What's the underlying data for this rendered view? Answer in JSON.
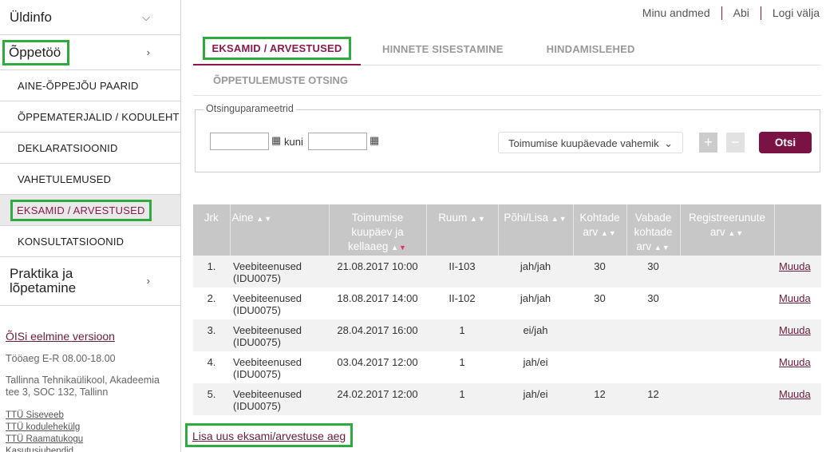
{
  "sidebar": {
    "uldinfo": "Üldinfo",
    "oppetoo": "Õppetöö",
    "items": [
      {
        "label": "AINE-ÕPPEJÕU PAARID"
      },
      {
        "label": "ÕPPEMATERJALID / KODULEHT"
      },
      {
        "label": "DEKLARATSIOONID"
      },
      {
        "label": "VAHETULEMUSED"
      },
      {
        "label": "EKSAMID / ARVESTUSED"
      },
      {
        "label": "KONSULTATSIOONID"
      }
    ],
    "praktika": "Praktika ja lõpetamine",
    "old_version": "ÕISi eelmine versioon",
    "hours": "Tööaeg E-R 08.00-18.00",
    "address": "Tallinna Tehnikaülikool, Akadeemia tee 3, SOC 132, Tallinn",
    "links": [
      "TTÜ Siseveeb",
      "TTÜ kodulehekülg",
      "TTÜ Raamatukogu",
      "Kasutusjuhendid"
    ]
  },
  "header": {
    "links": [
      "Minu andmed",
      "Abi",
      "Logi välja"
    ]
  },
  "tabs": {
    "row1": [
      "EKSAMID / ARVESTUSED",
      "HINNETE SISESTAMINE",
      "HINDAMISLEHED"
    ],
    "row2": [
      "ÕPPETULEMUSTE OTSING"
    ]
  },
  "search": {
    "legend": "Otsinguparameetrid",
    "kuni": "kuni",
    "range_select": "Toimumise kuupäevade vahemik",
    "plus": "+",
    "minus": "−",
    "submit": "Otsi"
  },
  "table": {
    "headers": [
      "Jrk",
      "Aine",
      "Toimumise kuupäev ja kellaaeg",
      "Ruum",
      "Põhi/Lisa",
      "Kohtade arv",
      "Vabade kohtade arv",
      "Registreerunute arv",
      ""
    ],
    "rows": [
      {
        "jrk": "1.",
        "aine": "Veebiteenused (IDU0075)",
        "aeg": "21.08.2017 10:00",
        "ruum": "II-103",
        "pohi": "jah/jah",
        "kohti": "30",
        "vabu": "30",
        "reg": "",
        "action": "Muuda"
      },
      {
        "jrk": "2.",
        "aine": "Veebiteenused (IDU0075)",
        "aeg": "18.08.2017 14:00",
        "ruum": "II-102",
        "pohi": "jah/jah",
        "kohti": "30",
        "vabu": "30",
        "reg": "",
        "action": "Muuda"
      },
      {
        "jrk": "3.",
        "aine": "Veebiteenused (IDU0075)",
        "aeg": "28.04.2017 16:00",
        "ruum": "1",
        "pohi": "ei/jah",
        "kohti": "",
        "vabu": "",
        "reg": "",
        "action": "Muuda"
      },
      {
        "jrk": "4.",
        "aine": "Veebiteenused (IDU0075)",
        "aeg": "03.04.2017 12:00",
        "ruum": "1",
        "pohi": "jah/ei",
        "kohti": "",
        "vabu": "",
        "reg": "",
        "action": "Muuda"
      },
      {
        "jrk": "5.",
        "aine": "Veebiteenused (IDU0075)",
        "aeg": "24.02.2017 12:00",
        "ruum": "1",
        "pohi": "jah/ei",
        "kohti": "12",
        "vabu": "12",
        "reg": "",
        "action": "Muuda"
      }
    ]
  },
  "add_link": "Lisa uus eksami/arvestuse aeg"
}
